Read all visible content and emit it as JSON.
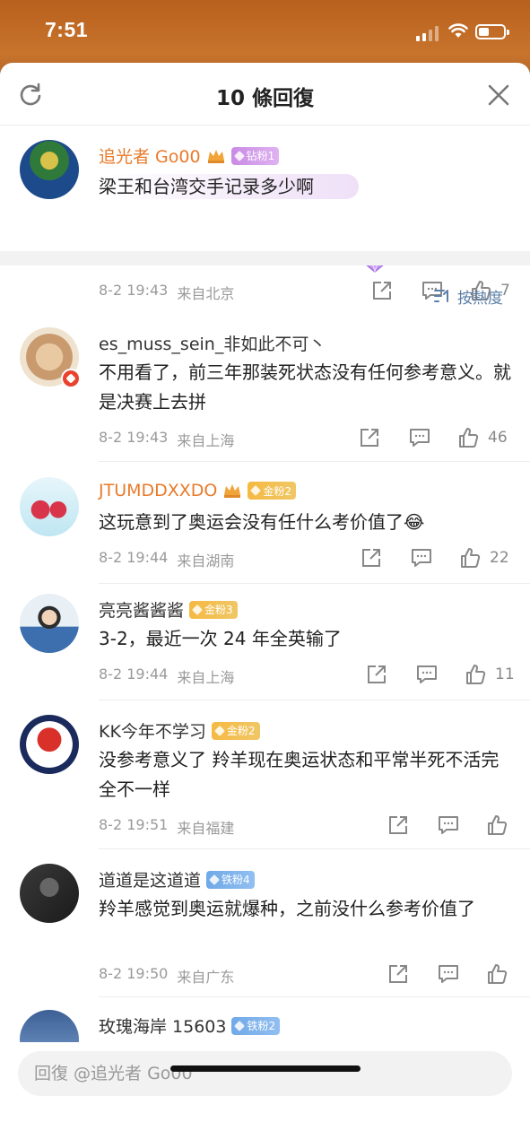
{
  "status_bar": {
    "time": "7:51"
  },
  "header": {
    "title": "10 條回復"
  },
  "top_comment": {
    "user": "追光者 Go00",
    "badge": "钻粉1",
    "text": "梁王和台湾交手记录多少啊",
    "time": "8-2 19:43",
    "location": "来自北京",
    "likes": "7"
  },
  "sort": {
    "label": "按熱度"
  },
  "comments": [
    {
      "user": "es_muss_sein_非如此不可丶",
      "badge": "",
      "text": "不用看了，前三年那装死状态没有任何参考意义。就是决赛上去拼",
      "time": "8-2 19:43",
      "location": "来自上海",
      "likes": "46"
    },
    {
      "user": "JTUMDDXXDO",
      "badge": "金粉2",
      "text": "这玩意到了奥运会没有任什么考价值了😂",
      "time": "8-2 19:44",
      "location": "来自湖南",
      "likes": "22"
    },
    {
      "user": "亮亮酱酱酱",
      "badge": "金粉3",
      "text": "3-2，最近一次 24 年全英输了",
      "time": "8-2 19:44",
      "location": "来自上海",
      "likes": "11"
    },
    {
      "user": "KK今年不学习",
      "badge": "金粉2",
      "text": "没参考意义了 羚羊现在奥运状态和平常半死不活完全不一样",
      "time": "8-2 19:51",
      "location": "来自福建",
      "likes": ""
    },
    {
      "user": "道道是这道道",
      "badge": "铁粉4",
      "text": "羚羊感觉到奥运就爆种，之前没什么参考价值了",
      "time": "8-2 19:50",
      "location": "来自广东",
      "likes": ""
    },
    {
      "user": "玫瑰海岸 15603",
      "badge": "铁粉2",
      "text": "",
      "time": "",
      "location": "",
      "likes": ""
    }
  ],
  "reply": {
    "placeholder": "回復 @追光者 Go00"
  },
  "colors": {
    "username_orange": "#e97a2a",
    "link_blue": "#5b7fa7",
    "gold_badge": "#f5b942",
    "iron_badge": "#6fa9e8",
    "diamond_badge": "#c98be5"
  }
}
